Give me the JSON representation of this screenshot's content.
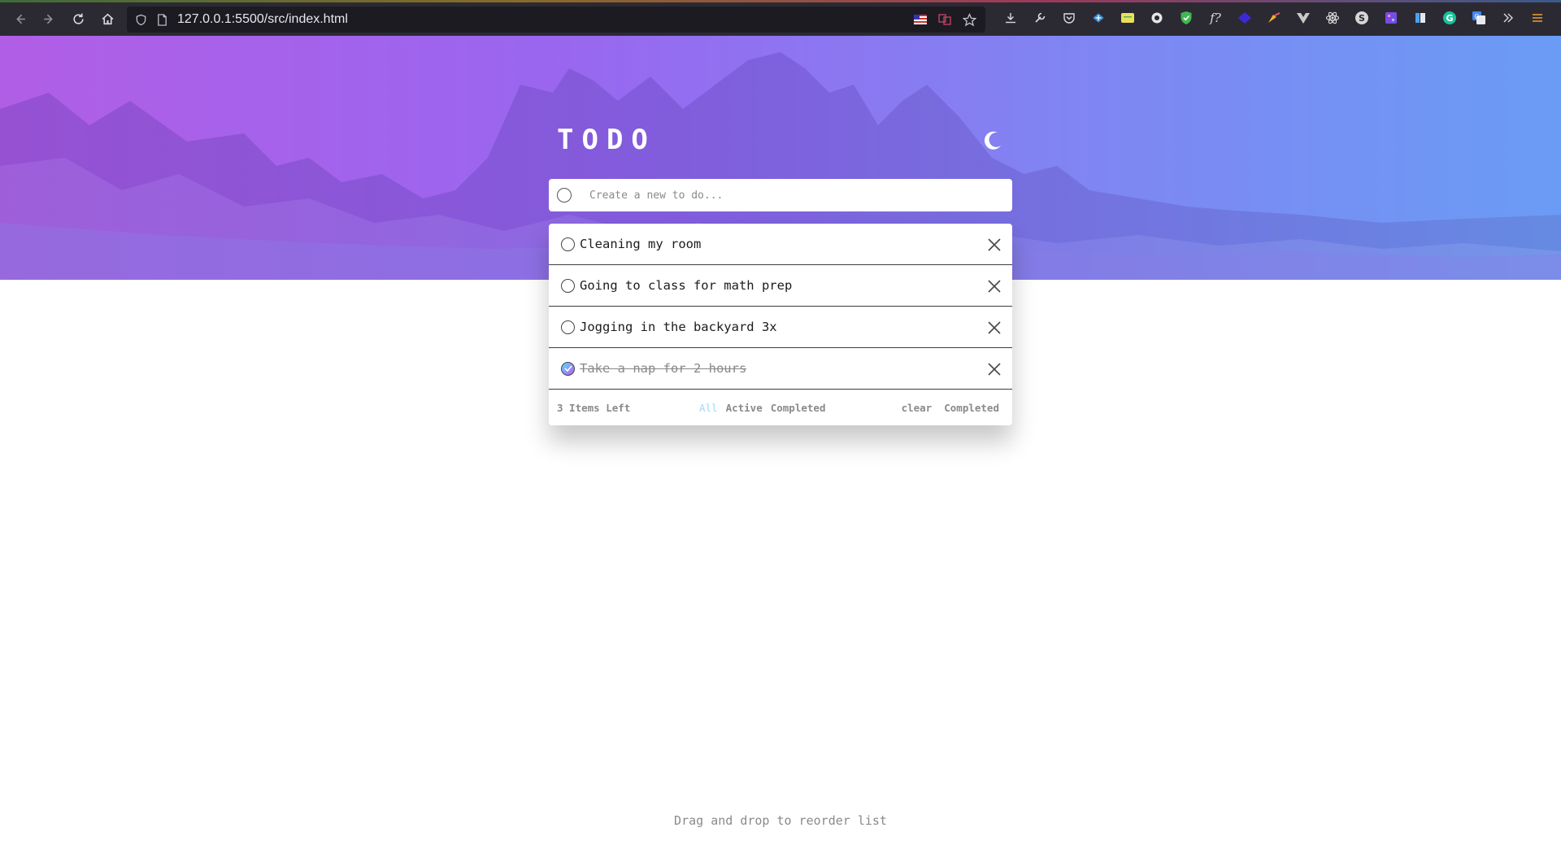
{
  "browser": {
    "url": "127.0.0.1:5500/src/index.html",
    "nav": [
      "back",
      "forward",
      "reload",
      "home"
    ]
  },
  "app": {
    "title": "TODO",
    "theme_icon": "moon-icon",
    "new_todo_placeholder": "Create a new to do...",
    "todos": [
      {
        "text": "Cleaning my room",
        "completed": false
      },
      {
        "text": "Going to class for math prep",
        "completed": false
      },
      {
        "text": "Jogging in the backyard 3x",
        "completed": false
      },
      {
        "text": "Take a nap for 2 hours",
        "completed": true
      }
    ],
    "footer": {
      "items_left": "3 Items Left",
      "filter_all": "All",
      "filter_active": "Active",
      "filter_completed": "Completed",
      "clear_completed": "clear  Completed"
    },
    "hint": "Drag and drop to reorder list"
  },
  "colors": {
    "hero_start": "#b15ee6",
    "hero_end": "#6a9cf5",
    "active_filter": "#9fd6f5",
    "check_gradient_start": "#57ddff",
    "check_gradient_end": "#c058f3"
  }
}
